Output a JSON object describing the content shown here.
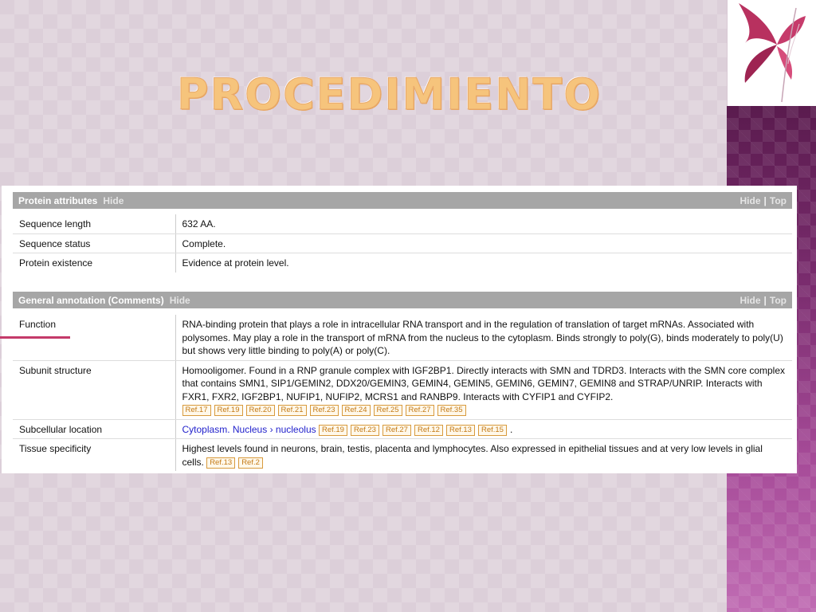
{
  "slide": {
    "title": "PROCEDIMIENTO"
  },
  "colors": {
    "title": "#f6c47c",
    "band": "#7a2c6e",
    "section_bar": "#a6a6a6",
    "ref_border": "#d89a3d",
    "link": "#2222cc",
    "highlight": "#c43a6a"
  },
  "protein_attributes": {
    "title": "Protein attributes",
    "hide": "Hide",
    "nav_hide": "Hide",
    "nav_sep": "|",
    "nav_top": "Top",
    "rows": [
      {
        "label": "Sequence length",
        "value": "632 AA."
      },
      {
        "label": "Sequence status",
        "value": "Complete."
      },
      {
        "label": "Protein existence",
        "value": "Evidence at protein level."
      }
    ]
  },
  "general_annotation": {
    "title": "General annotation (Comments)",
    "hide": "Hide",
    "nav_hide": "Hide",
    "nav_sep": "|",
    "nav_top": "Top",
    "function": {
      "label": "Function",
      "text": "RNA-binding protein that plays a role in intracellular RNA transport and in the regulation of translation of target mRNAs. Associated with polysomes. May play a role in the transport of mRNA from the nucleus to the cytoplasm. Binds strongly to poly(G), binds moderately to poly(U) but shows very little binding to poly(A) or poly(C)."
    },
    "subunit": {
      "label": "Subunit structure",
      "text": "Homooligomer. Found in a RNP granule complex with IGF2BP1. Directly interacts with SMN and TDRD3. Interacts with the SMN core complex that contains SMN1, SIP1/GEMIN2, DDX20/GEMIN3, GEMIN4, GEMIN5, GEMIN6, GEMIN7, GEMIN8 and STRAP/UNRIP. Interacts with FXR1, FXR2, IGF2BP1, NUFIP1, NUFIP2, MCRS1 and RANBP9. Interacts with CYFIP1 and CYFIP2.",
      "refs": [
        "Ref.17",
        "Ref.19",
        "Ref.20",
        "Ref.21",
        "Ref.23",
        "Ref.24",
        "Ref.25",
        "Ref.27",
        "Ref.35"
      ]
    },
    "subcellular": {
      "label": "Subcellular location",
      "link1": "Cytoplasm",
      "sep1": ".",
      "link2": "Nucleus",
      "arrow": "›",
      "link3": "nucleolus",
      "refs": [
        "Ref.19",
        "Ref.23",
        "Ref.27",
        "Ref.12",
        "Ref.13",
        "Ref.15"
      ],
      "end": "."
    },
    "tissue": {
      "label": "Tissue specificity",
      "text": "Highest levels found in neurons, brain, testis, placenta and lymphocytes. Also expressed in epithelial tissues and at very low levels in glial cells.",
      "refs": [
        "Ref.13",
        "Ref.2"
      ]
    }
  }
}
